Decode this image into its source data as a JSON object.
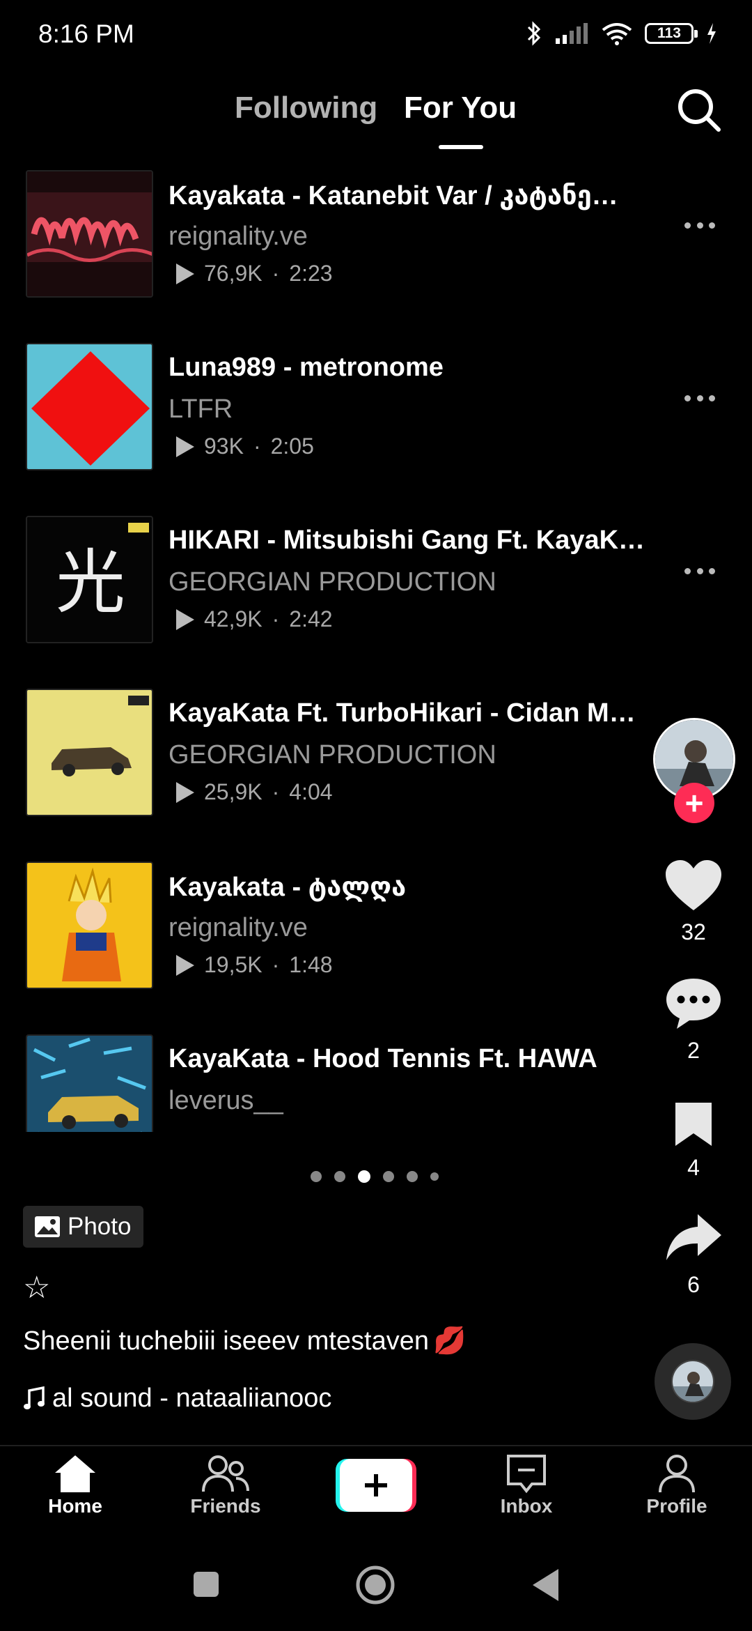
{
  "status_bar": {
    "time": "8:16 PM",
    "battery": "113"
  },
  "top_nav": {
    "following_label": "Following",
    "foryou_label": "For You"
  },
  "tracks": [
    {
      "title": "Kayakata - Katanebit Var / კატანე…",
      "artist": "reignality.ve",
      "plays": "76,9K",
      "duration": "2:23"
    },
    {
      "title": "Luna989 - metronome",
      "artist": "LTFR",
      "plays": "93K",
      "duration": "2:05"
    },
    {
      "title": "HIKARI - Mitsubishi Gang Ft. KayaK…",
      "artist": "GEORGIAN PRODUCTION",
      "plays": "42,9K",
      "duration": "2:42"
    },
    {
      "title": "KayaKata Ft. TurboHikari - Cidan M…",
      "artist": "GEORGIAN PRODUCTION",
      "plays": "25,9K",
      "duration": "4:04"
    },
    {
      "title": "Kayakata - ტალღა",
      "artist": "reignality.ve",
      "plays": "19,5K",
      "duration": "1:48"
    },
    {
      "title": "KayaKata - Hood Tennis Ft. HAWA",
      "artist": "leverus__",
      "plays": "",
      "duration": ""
    }
  ],
  "pager": {
    "count": 6,
    "active_index": 2
  },
  "post": {
    "type_label": "Photo",
    "star": "☆",
    "caption": "Sheenii tuchebiii iseeev mtestaven",
    "caption_emoji": "💋",
    "sound": "al sound - nataaliianooc"
  },
  "rail": {
    "likes": "32",
    "comments": "2",
    "saves": "4",
    "shares": "6"
  },
  "bottom_nav": {
    "home": "Home",
    "friends": "Friends",
    "inbox": "Inbox",
    "profile": "Profile"
  },
  "colors": {
    "accent": "#fe2c55",
    "cyan": "#25f4ee",
    "muted": "#9a9a9a"
  },
  "thumbnails": [
    "red-georgian-lettering-art",
    "red-diamond-on-blue",
    "kanji-hikari-art",
    "yellow-car-art",
    "anime-character-yellow",
    "blue-pattern-car-art"
  ]
}
